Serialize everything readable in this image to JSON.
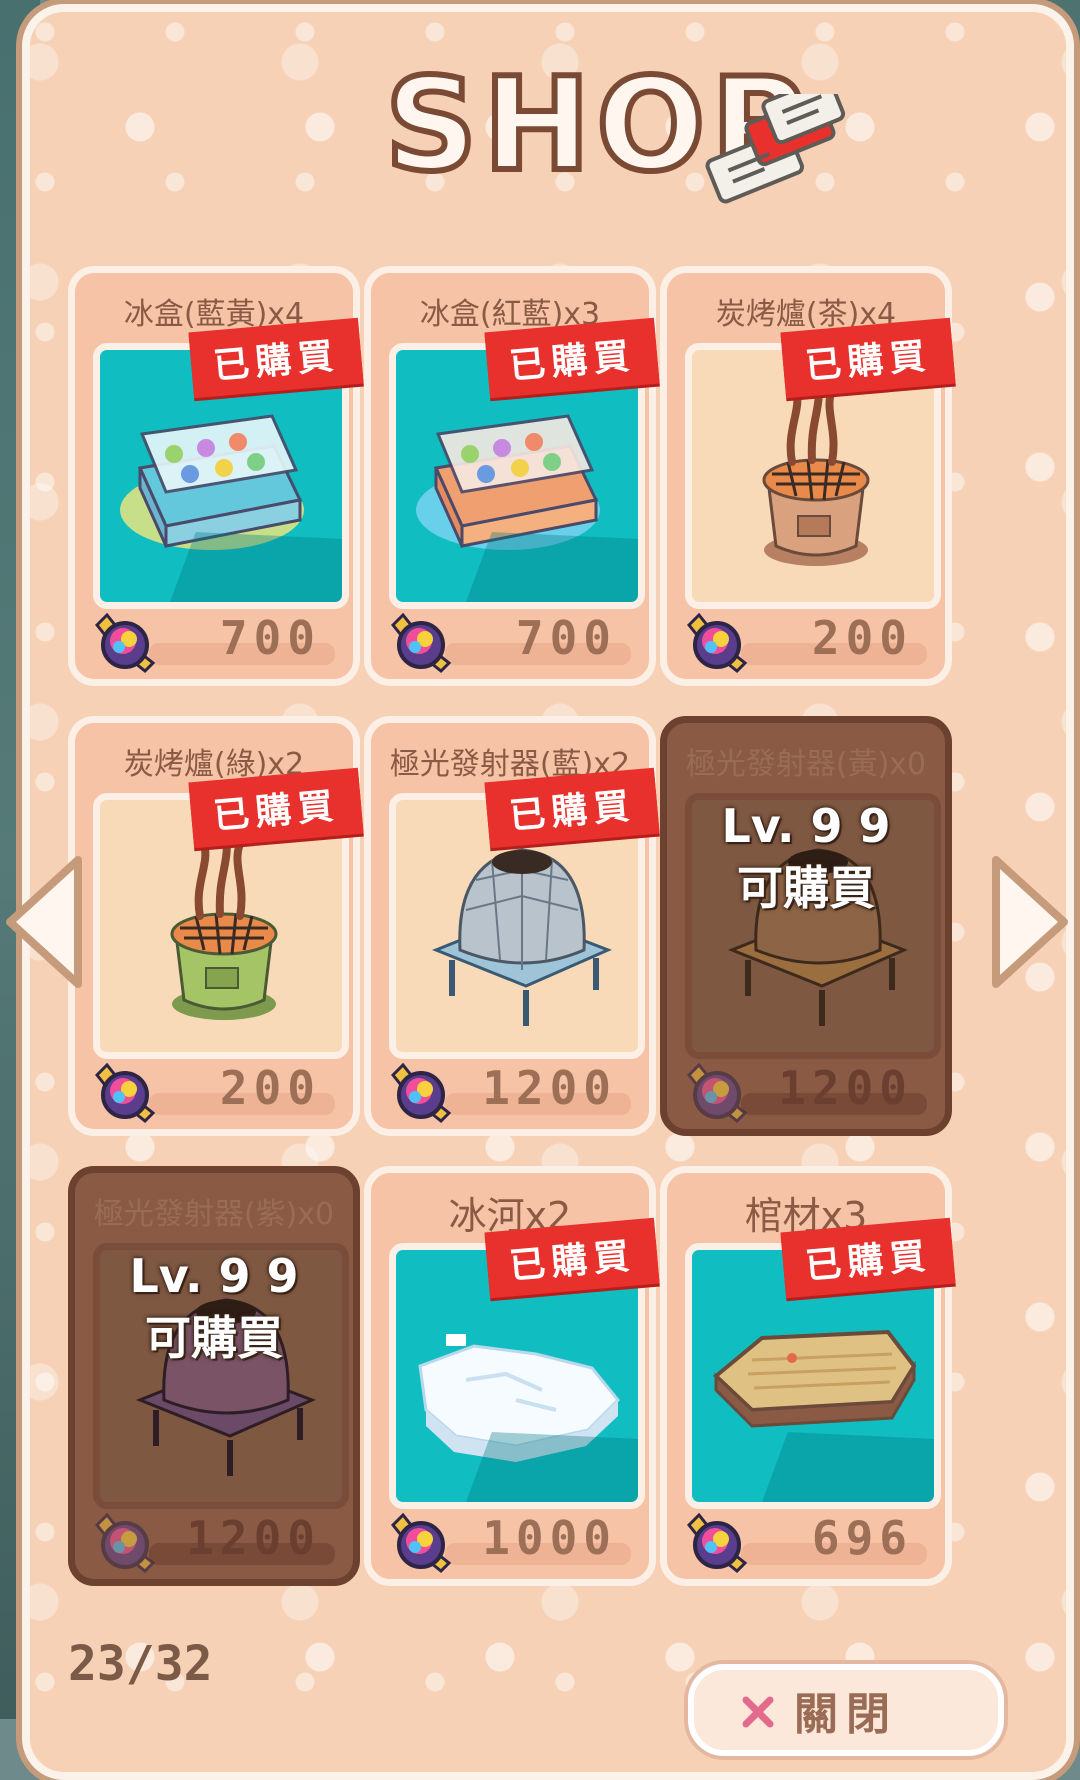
{
  "header": {
    "title": "SHOP"
  },
  "shop": {
    "items": [
      {
        "name": "冰盒(藍黃)x4",
        "price": "700",
        "status": "已購買",
        "bg": "sea"
      },
      {
        "name": "冰盒(紅藍)x3",
        "price": "700",
        "status": "已購買",
        "bg": "sea"
      },
      {
        "name": "炭烤爐(茶)x4",
        "price": "200",
        "status": "已購買",
        "bg": "sand"
      },
      {
        "name": "炭烤爐(綠)x2",
        "price": "200",
        "status": "已購買",
        "bg": "sand"
      },
      {
        "name": "極光發射器(藍)x2",
        "price": "1200",
        "status": "已購買",
        "bg": "sand"
      },
      {
        "name": "極光發射器(黃)x0",
        "price": "1200",
        "lock_level": "Lv. 9 9",
        "lock_note": "可購買"
      },
      {
        "name": "極光發射器(紫)x0",
        "price": "1200",
        "lock_level": "Lv. 9 9",
        "lock_note": "可購買"
      },
      {
        "name": "冰河x2",
        "price": "1000",
        "status": "已購買",
        "bg": "sea"
      },
      {
        "name": "棺材x3",
        "price": "696",
        "status": "已購買",
        "bg": "sea"
      }
    ]
  },
  "pager": {
    "page": "23/32"
  },
  "footer": {
    "close_label": "關閉"
  },
  "colors": {
    "panel": "#f6d1b6",
    "card": "#f6c3a6",
    "badge": "#e8302c",
    "sea": "#10bdc0",
    "locked": "#8b5a44"
  },
  "icons": [
    "ticket-icon",
    "gem-currency-icon",
    "left-arrow-icon",
    "right-arrow-icon",
    "close-icon"
  ]
}
